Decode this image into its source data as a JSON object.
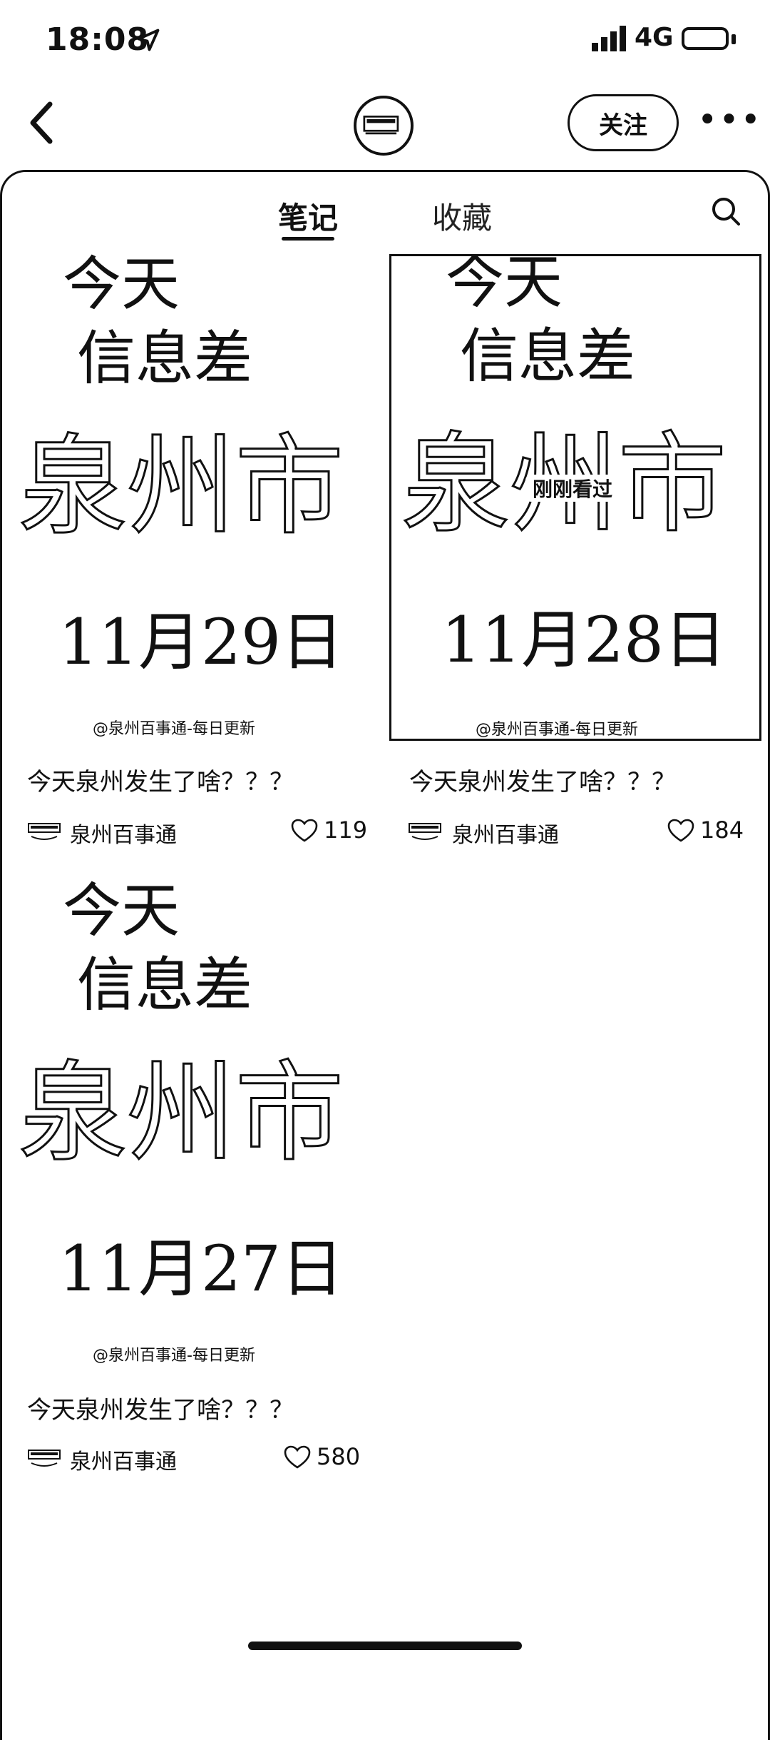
{
  "status_bar": {
    "time": "18:08",
    "network": "4G"
  },
  "header": {
    "follow_label": "关注",
    "more_label": "•••"
  },
  "tabs": [
    {
      "label": "笔记",
      "active": true
    },
    {
      "label": "收藏",
      "active": false
    }
  ],
  "notes": [
    {
      "cover": {
        "line1": "今天",
        "line2": "信息差",
        "city": "泉州市",
        "date": "11月29日",
        "watermark": "@泉州百事通-每日更新"
      },
      "title": "今天泉州发生了啥？？？",
      "author": "泉州百事通",
      "likes": "119"
    },
    {
      "cover": {
        "line1": "今天",
        "line2": "信息差",
        "city": "泉州市",
        "date": "11月28日",
        "watermark": "@泉州百事通-每日更新"
      },
      "badge": "刚刚看过",
      "title": "今天泉州发生了啥？？？",
      "author": "泉州百事通",
      "likes": "184"
    },
    {
      "cover": {
        "line1": "今天",
        "line2": "信息差",
        "city": "泉州市",
        "date": "11月27日",
        "watermark": "@泉州百事通-每日更新"
      },
      "title": "今天泉州发生了啥？？？",
      "author": "泉州百事通",
      "likes": "580"
    }
  ]
}
